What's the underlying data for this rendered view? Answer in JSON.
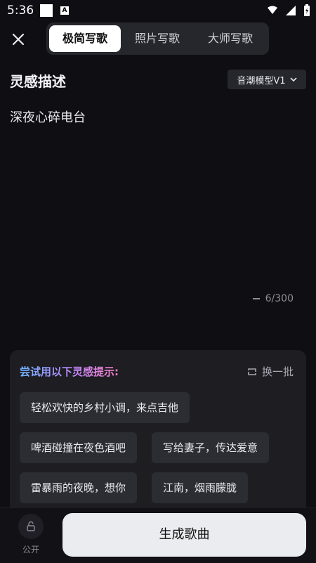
{
  "status": {
    "time": "5:36"
  },
  "tabs": [
    {
      "label": "极简写歌",
      "active": true
    },
    {
      "label": "照片写歌",
      "active": false
    },
    {
      "label": "大师写歌",
      "active": false
    }
  ],
  "inspiration": {
    "title": "灵感描述",
    "model": "音潮模型V1"
  },
  "prompt": {
    "text": "深夜心碎电台",
    "counter": "6/300"
  },
  "hints": {
    "title": "尝试用以下灵感提示:",
    "refresh_label": "换一批",
    "chips": [
      "轻松欢快的乡村小调，来点吉他",
      "啤酒碰撞在夜色酒吧",
      "写给妻子，传达爱意",
      "雷暴雨的夜晚，想你",
      "江南，烟雨朦胧"
    ]
  },
  "bottom": {
    "public_label": "公开",
    "generate_label": "生成歌曲"
  },
  "colors": {
    "background": "#0f0f13",
    "panel": "#1d1d22",
    "chip": "#2c2c33",
    "generate_button": "#ebecef"
  }
}
